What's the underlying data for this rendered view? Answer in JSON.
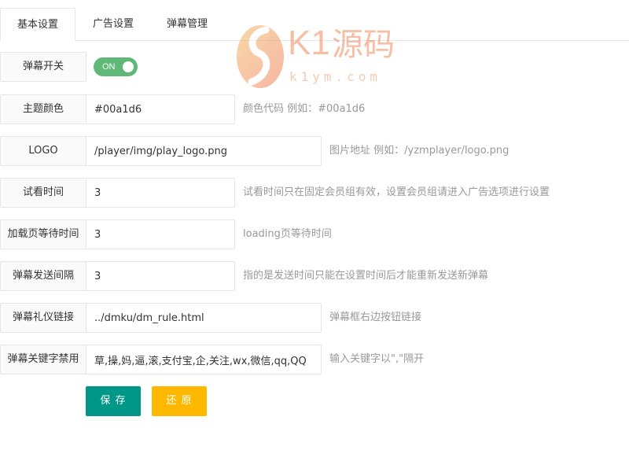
{
  "tabs": [
    "基本设置",
    "广告设置",
    "弹幕管理"
  ],
  "fields": {
    "danmaku_switch": {
      "label": "弹幕开关",
      "value": "ON"
    },
    "theme_color": {
      "label": "主题颜色",
      "value": "#00a1d6",
      "hint": "颜色代码 例如：#00a1d6"
    },
    "logo": {
      "label": "LOGO",
      "value": "/player/img/play_logo.png",
      "hint": "图片地址 例如：/yzmplayer/logo.png"
    },
    "trial_time": {
      "label": "试看时间",
      "value": "3",
      "hint": "试看时间只在固定会员组有效，设置会员组请进入广告选项进行设置"
    },
    "loading_wait": {
      "label": "加载页等待时间",
      "value": "3",
      "hint": "loading页等待时间"
    },
    "send_interval": {
      "label": "弹幕发送间隔",
      "value": "3",
      "hint": "指的是发送时间只能在设置时间后才能重新发送新弹幕"
    },
    "etiquette_link": {
      "label": "弹幕礼仪链接",
      "value": "../dmku/dm_rule.html",
      "hint": "弹幕框右边按钮链接"
    },
    "banned_keywords": {
      "label": "弹幕关键字禁用",
      "value": "草,操,妈,逼,滚,支付宝,企,关注,wx,微信,qq,QQ",
      "hint": "输入关键字以\",\"隔开"
    }
  },
  "buttons": {
    "save": "保 存",
    "reset": "还 原"
  },
  "watermark": {
    "brand_k1": "K1",
    "brand_han": "源码",
    "url": "k1ym.com"
  },
  "colors": {
    "toggle_on": "#5fb878",
    "save": "#009688",
    "reset": "#ffb800",
    "hint": "#999999"
  }
}
